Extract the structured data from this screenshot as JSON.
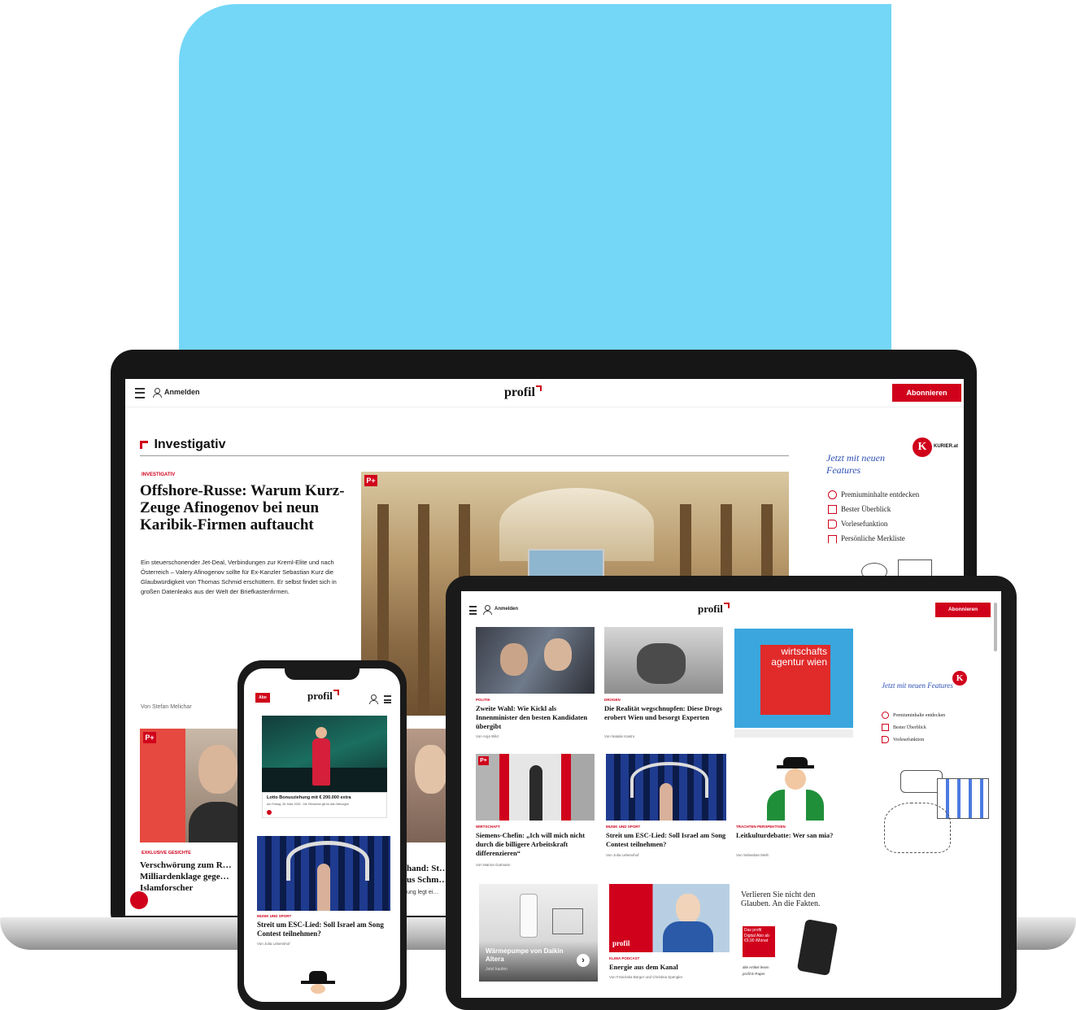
{
  "colors": {
    "hero": "#74d7f7",
    "brand_red": "#d0021b",
    "text": "#111111"
  },
  "laptop": {
    "login_label": "Anmelden",
    "logo": "profil",
    "subscribe_label": "Abonnieren",
    "section_title": "Investigativ",
    "lead": {
      "kicker": "Investigativ",
      "headline": "Offshore-Russe: Warum Kurz-Zeuge Afinogenov bei neun Karibik-Firmen auftaucht",
      "teaser": "Ein steuerschonender Jet-Deal, Verbindungen zur Kreml-Elite und nach Österreich – Valery Afinogenov sollte für Ex-Kanzler Sebastian Kurz die Glaubwürdigkeit von Thomas Schmid erschüttern. Er selbst findet sich in großen Datenleaks aus der Welt der Briefkastenfirmen.",
      "author": "Von Stefan Melichar",
      "badge": "P+"
    },
    "second": {
      "kicker": "Exklusive Gesichte",
      "headline": "Verschwörung zum R… Milliardenklage gege… Islamforscher",
      "badge": "P+"
    },
    "third": {
      "headline_fragment": "hand: St… us Schm…",
      "text_fragment": "ung legt ei…"
    },
    "promo": {
      "title": "Jetzt mit neuen Features",
      "brand": "KURIER.at",
      "features": [
        "Premiuminhalte entdecken",
        "Bester Überblick",
        "Vorlesefunktion",
        "Persönliche Merkliste"
      ]
    }
  },
  "tablet": {
    "login_label": "Anmelden",
    "logo": "profil",
    "subscribe_label": "Abonnieren",
    "ad_text": "wirtschafts agentur wien",
    "cards": [
      {
        "kicker": "Politik",
        "headline": "Zweite Wahl: Wie Kickl als Innenminister den besten Kandidaten übergibt",
        "author": "Von Anja Wild"
      },
      {
        "kicker": "Drogen",
        "headline": "Die Realität wegschnupfen: Diese Drogs erobert Wien und besorgt Experten",
        "author": "Von Natalie Kastro"
      },
      {
        "kicker": "Wirtschaft",
        "headline": "Siemens-Chefin: „Ich will mich nicht durch die billigere Arbeitskraft differenzieren“",
        "author": "Von Marina Gutmann"
      },
      {
        "kicker": "Musik und Sport",
        "headline": "Streit um ESC-Lied: Soll Israel am Song Contest teilnehmen?",
        "author": "Von Julia Lebenshof"
      },
      {
        "kicker": "Trachten Perspektiven",
        "headline": "Leitkulturdebatte: Wer san mia?",
        "author": "Von Sebastian Meilt"
      },
      {
        "kicker": "Klima Podcast",
        "headline": "Energie aus dem Kanal",
        "author": "Von Franziska Bürger und Christina Spengler"
      }
    ],
    "heat_card": {
      "title": "Wärmepumpe von Daikin Altera",
      "sub": "Jetzt kaufen"
    },
    "promo": {
      "title": "Jetzt mit neuen Features",
      "features": [
        "Premiuminhalte entdecken",
        "Bester Überblick",
        "Vorlesefunktion"
      ]
    },
    "offer": {
      "headline": "Verlieren Sie nicht den Glauben. An die Fakten.",
      "box": "Das profil Digital Abo ab €9,90 /Monat",
      "checks": [
        "alle Artikel lesen",
        "profil E-Paper"
      ]
    }
  },
  "phone": {
    "badge": "Abo",
    "logo": "profil",
    "ad_title": "Lotto Bonusziehung mit € 200.000 extra",
    "ad_sub": "Am Freitag, 28. März 2025 · Die Teilnahme gilt für alle Ziehungen",
    "kicker": "Musik und Sport",
    "headline": "Streit um ESC-Lied: Soll Israel am Song Contest teilnehmen?",
    "author": "Von Julia Lebenshof"
  }
}
